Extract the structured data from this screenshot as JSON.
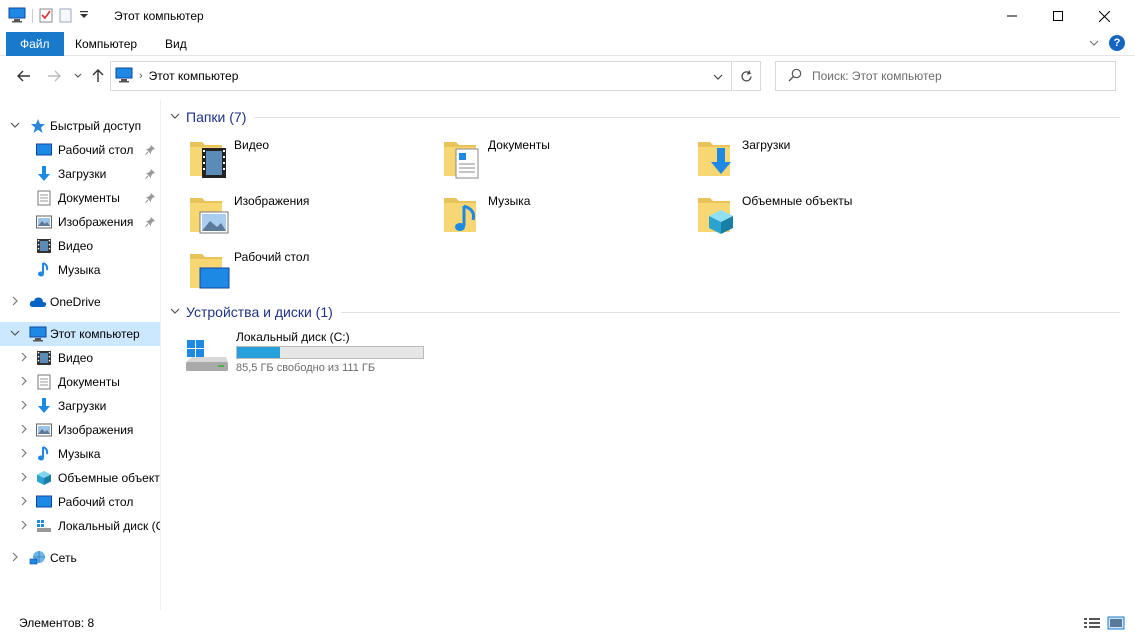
{
  "window": {
    "title": "Этот компьютер"
  },
  "ribbon": {
    "tabs": [
      "Файл",
      "Компьютер",
      "Вид"
    ]
  },
  "address": {
    "path": "Этот компьютер"
  },
  "search": {
    "placeholder": "Поиск: Этот компьютер"
  },
  "sidebar": {
    "quick_access": "Быстрый доступ",
    "quick_items": [
      "Рабочий стол",
      "Загрузки",
      "Документы",
      "Изображения",
      "Видео",
      "Музыка"
    ],
    "onedrive": "OneDrive",
    "this_pc": "Этот компьютер",
    "pc_items": [
      "Видео",
      "Документы",
      "Загрузки",
      "Изображения",
      "Музыка",
      "Объемные объекты",
      "Рабочий стол",
      "Локальный диск (C:)"
    ],
    "network": "Сеть"
  },
  "folders": {
    "header": "Папки (7)",
    "items": [
      "Видео",
      "Документы",
      "Загрузки",
      "Изображения",
      "Музыка",
      "Объемные объекты",
      "Рабочий стол"
    ]
  },
  "devices": {
    "header": "Устройства и диски (1)",
    "drive_name": "Локальный диск (C:)",
    "drive_free": "85,5 ГБ свободно из 111 ГБ",
    "used_fraction": 0.23
  },
  "status": {
    "items_count": "Элементов: 8"
  },
  "colors": {
    "accent": "#1979ca",
    "selection": "#cce8ff",
    "group_title": "#1e3287",
    "drive_bar": "#26a0da"
  }
}
